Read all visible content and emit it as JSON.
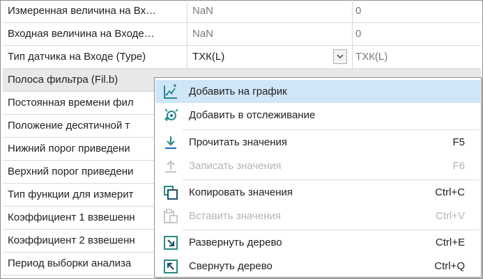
{
  "table": {
    "rows": [
      {
        "name": "Измеренная величина на Вх…",
        "value": "NaN",
        "default": "0"
      },
      {
        "name": "Входная величина на Входе…",
        "value": "NaN",
        "default": "0"
      },
      {
        "name": "Тип датчика на Входе (Type)",
        "value": "ТХК(L)",
        "default": "ТХК(L)"
      },
      {
        "name": "Полоса фильтра (Fil.b)",
        "value": "",
        "default": ""
      },
      {
        "name": "Постоянная времени фил",
        "value": "",
        "default": ""
      },
      {
        "name": "Положение десятичной т",
        "value": "",
        "default": ""
      },
      {
        "name": "Нижний порог приведени",
        "value": "",
        "default": ""
      },
      {
        "name": "Верхний порог приведени",
        "value": "",
        "default": ""
      },
      {
        "name": "Тип функции для измерит",
        "value": "",
        "default": ""
      },
      {
        "name": "Коэффициент 1 взвешенн",
        "value": "",
        "default": ""
      },
      {
        "name": "Коэффициент 2 взвешенн",
        "value": "",
        "default": ""
      },
      {
        "name": "Период выборки анализа",
        "value": "",
        "default": ""
      }
    ]
  },
  "context_menu": {
    "items": [
      {
        "label": "Добавить на график",
        "shortcut": "",
        "icon": "chart-add-icon",
        "enabled": true,
        "highlighted": true
      },
      {
        "label": "Добавить в отслеживание",
        "shortcut": "",
        "icon": "watch-add-icon",
        "enabled": true
      },
      {
        "label": "Прочитать значения",
        "shortcut": "F5",
        "icon": "read-download-icon",
        "enabled": true
      },
      {
        "label": "Записать значения",
        "shortcut": "F6",
        "icon": "write-upload-icon",
        "enabled": false
      },
      {
        "label": "Копировать значения",
        "shortcut": "Ctrl+C",
        "icon": "copy-icon",
        "enabled": true
      },
      {
        "label": "Вставить значения",
        "shortcut": "Ctrl+V",
        "icon": "paste-icon",
        "enabled": false
      },
      {
        "label": "Развернуть дерево",
        "shortcut": "Ctrl+E",
        "icon": "expand-tree-icon",
        "enabled": true
      },
      {
        "label": "Свернуть дерево",
        "shortcut": "Ctrl+Q",
        "icon": "collapse-tree-icon",
        "enabled": true
      }
    ]
  },
  "colors": {
    "accent_teal": "#2a8a84",
    "accent_blue": "#1e6fb5",
    "menu_highlight": "#cfe6f7",
    "selected_row": "#e8e8e8",
    "disabled_text": "#b4b4b4"
  }
}
